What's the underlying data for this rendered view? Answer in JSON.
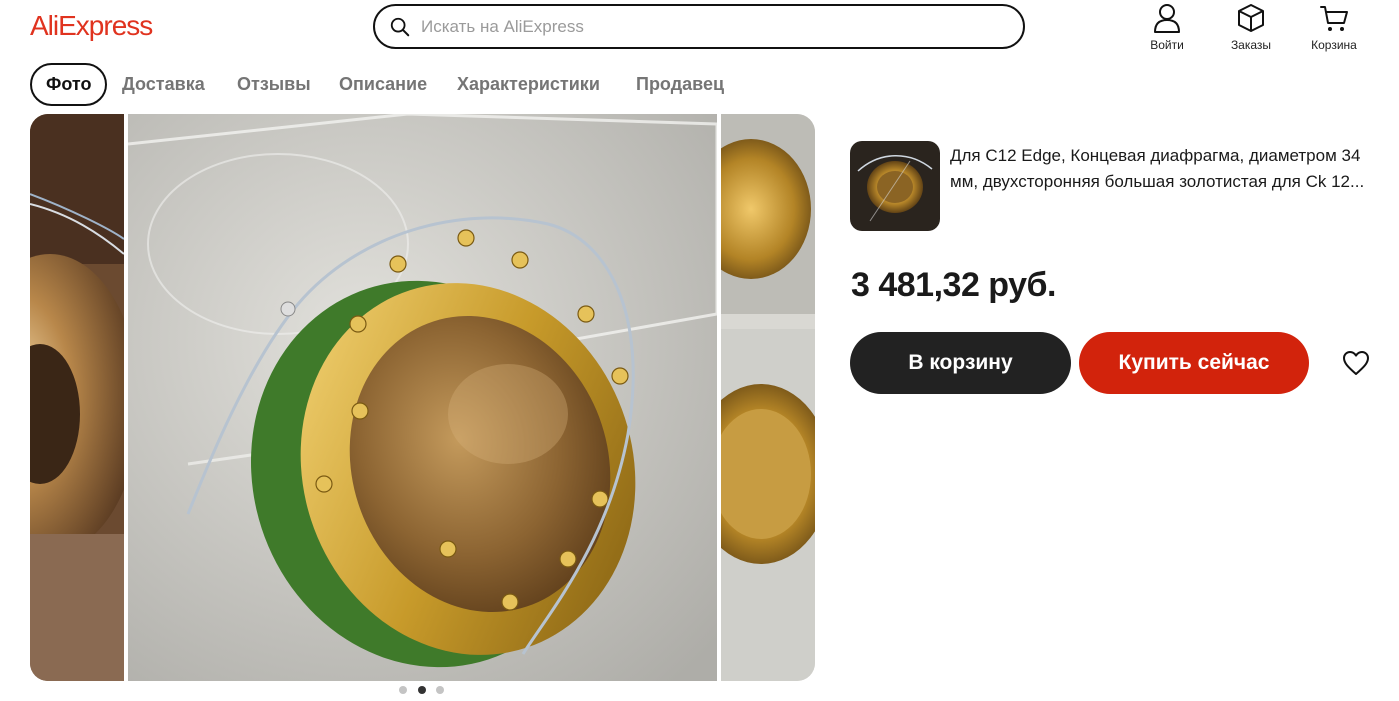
{
  "header": {
    "logo": "AliExpress",
    "search": {
      "placeholder": "Искать на AliExpress",
      "icon": "search-icon"
    },
    "actions": [
      {
        "label": "Войти",
        "icon": "user-icon"
      },
      {
        "label": "Заказы",
        "icon": "box-icon"
      },
      {
        "label": "Корзина",
        "icon": "cart-icon"
      }
    ]
  },
  "tabs": [
    {
      "label": "Фото",
      "active": true
    },
    {
      "label": "Доставка"
    },
    {
      "label": "Отзывы"
    },
    {
      "label": "Описание"
    },
    {
      "label": "Характеристики"
    },
    {
      "label": "Продавец"
    }
  ],
  "gallery": {
    "total": 3,
    "active_index": 1
  },
  "product": {
    "title": "Для C12 Edge, Концевая диафрагма, диаметром 34 мм, двухсторонняя большая золотистая для Ck 12...",
    "price": "3 481,32 руб.",
    "add_to_cart": "В корзину",
    "buy_now": "Купить сейчас",
    "favorite_icon": "heart-icon"
  },
  "colors": {
    "brand": "#e0331f",
    "buy_button": "#d2230c",
    "cart_button": "#222222"
  }
}
